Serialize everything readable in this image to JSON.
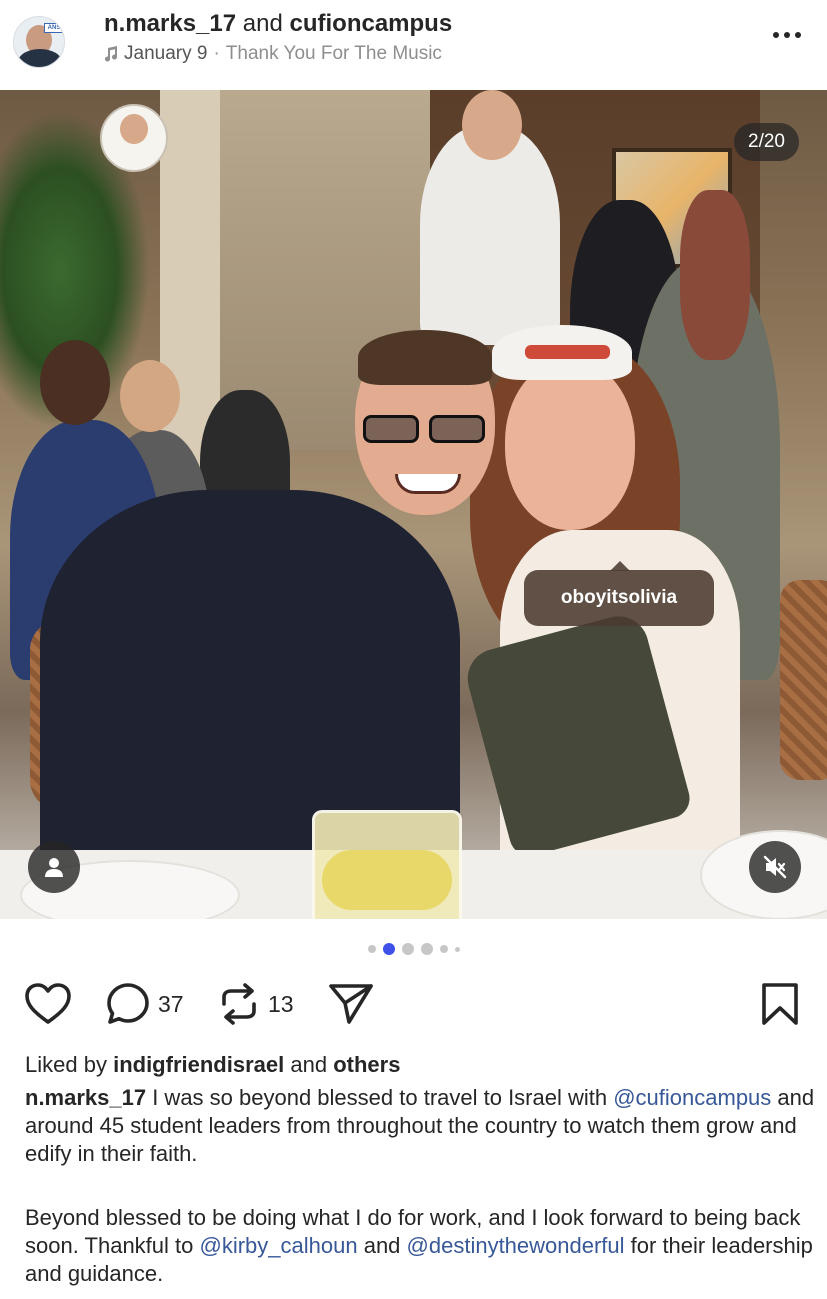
{
  "header": {
    "user1": "n.marks_17",
    "joiner": "and",
    "user2": "cufioncampus",
    "date": "January 9",
    "separator": "·",
    "song": "Thank You For The Music",
    "avatar_badge": "ANS"
  },
  "photo": {
    "counter": "2/20",
    "tag": "oboyitsolivia",
    "carousel_dots": 6,
    "active_dot": 1
  },
  "actions": {
    "comments_count": "37",
    "reposts_count": "13"
  },
  "likes": {
    "prefix": "Liked by",
    "user": "indigfriendisrael",
    "joiner": "and",
    "others": "others"
  },
  "caption": {
    "author": "n.marks_17",
    "p1_a": " I was so beyond blessed to travel to Israel with ",
    "p1_mention": "@cufioncampus",
    "p1_b": " and around 45 student leaders from throughout the country to watch them grow and edify in their faith.",
    "p2_a": "Beyond blessed to be doing what I do for work, and I look forward to being back soon. Thankful to ",
    "p2_mention1": "@kirby_calhoun",
    "p2_b": " and ",
    "p2_mention2": "@destinythewonderful",
    "p2_c": " for their leadership and guidance."
  },
  "colors": {
    "active_dot": "#3f51e8",
    "mention": "#385898",
    "text": "#262626"
  }
}
